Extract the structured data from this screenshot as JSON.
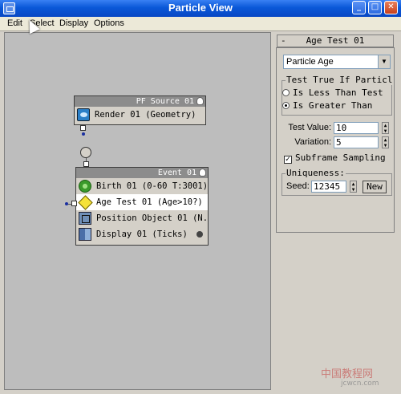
{
  "window": {
    "title": "Particle View"
  },
  "menu": [
    "Edit",
    "Select",
    "Display",
    "Options"
  ],
  "nodes": {
    "source": {
      "title": "PF Source 01",
      "operators": [
        {
          "label": "Render 01 (Geometry)",
          "icon": "render-icon"
        }
      ]
    },
    "event": {
      "title": "Event 01",
      "operators": [
        {
          "label": "Birth 01 (0-60 T:3001)",
          "icon": "birth-icon"
        },
        {
          "label": "Age Test 01 (Age>10?)",
          "icon": "age-test-icon",
          "selected": true
        },
        {
          "label": "Position Object 01 (N...",
          "icon": "position-object-icon"
        },
        {
          "label": "Display 01 (Ticks)",
          "icon": "display-icon"
        }
      ]
    }
  },
  "panel": {
    "rollout_title": "Age Test 01",
    "collapse_glyph": "-",
    "test_type": "Particle Age",
    "group_test_label": "Test True If Particl",
    "radio_less": "Is Less Than Test",
    "radio_greater": "Is Greater Than",
    "selected_radio": "greater",
    "test_value_label": "Test Value:",
    "test_value": "10",
    "variation_label": "Variation:",
    "variation": "5",
    "subframe_label": "Subframe Sampling",
    "subframe_checked": true,
    "uniqueness_label": "Uniqueness:",
    "seed_label": "Seed:",
    "seed": "12345",
    "new_button": "New"
  },
  "watermark": {
    "main": "中国教程网",
    "sub": "jcwcn.com"
  }
}
